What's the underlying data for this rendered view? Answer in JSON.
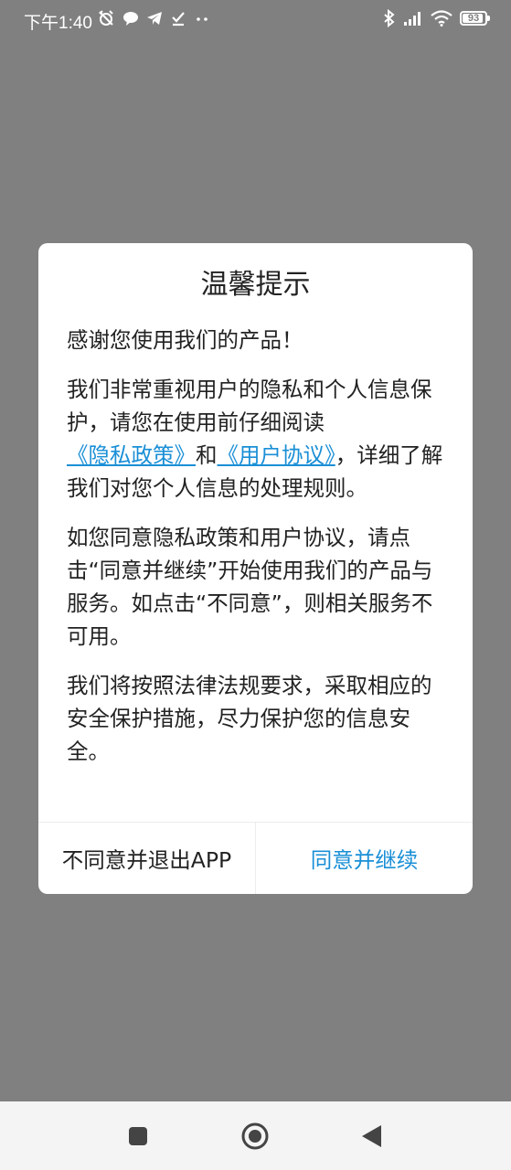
{
  "status_bar": {
    "time": "下午1:40",
    "battery_level": "93",
    "icons_left": [
      "muted-alarm-icon",
      "chat-bubble-icon",
      "telegram-icon",
      "download-done-icon",
      "more-dots-icon"
    ],
    "icons_right": [
      "bluetooth-icon",
      "signal-icon",
      "wifi-icon",
      "battery-icon"
    ]
  },
  "dialog": {
    "title": "温馨提示",
    "greeting": "感谢您使用我们的产品！",
    "paragraph2": {
      "text_before": "我们非常重视用户的隐私和个人信息保护，请您在使用前仔细阅读",
      "privacy_link": "《隐私政策》",
      "connector": "和",
      "agreement_link": "《用户协议》",
      "text_after": "，详细了解我们对您个人信息的处理规则。"
    },
    "paragraph3": "如您同意隐私政策和用户协议，请点击“同意并继续”开始使用我们的产品与服务。如点击“不同意”，则相关服务不可用。",
    "paragraph4": "我们将按照法律法规要求，采取相应的安全保护措施，尽力保护您的信息安全。",
    "decline_label": "不同意并退出APP",
    "agree_label": "同意并继续"
  },
  "colors": {
    "overlay": "#808080",
    "link": "#1a8fd6",
    "text": "#222222"
  },
  "nav_bar": {
    "icons": [
      "recent-apps-icon",
      "home-icon",
      "back-icon"
    ]
  }
}
